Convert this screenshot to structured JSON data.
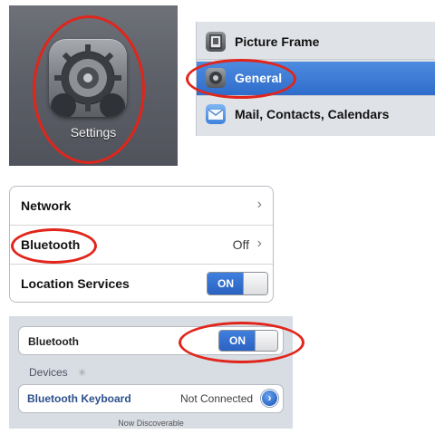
{
  "settings_app": {
    "label": "Settings",
    "icon": "gear-icon"
  },
  "sidebar": {
    "items": [
      {
        "label": "Picture Frame",
        "icon": "picture-frame-icon",
        "selected": false
      },
      {
        "label": "General",
        "icon": "gear-icon",
        "selected": true
      },
      {
        "label": "Mail, Contacts, Calendars",
        "icon": "mail-icon",
        "selected": false
      }
    ]
  },
  "general_settings": {
    "rows": [
      {
        "label": "Network",
        "value": "",
        "accessory": "chevron"
      },
      {
        "label": "Bluetooth",
        "value": "Off",
        "accessory": "chevron"
      },
      {
        "label": "Location Services",
        "value": "",
        "accessory": "switch",
        "switch_label": "ON"
      }
    ]
  },
  "bluetooth_screen": {
    "toggle_label": "Bluetooth",
    "toggle_value": "ON",
    "devices_header": "Devices",
    "device": {
      "name": "Bluetooth Keyboard",
      "status": "Not Connected"
    },
    "footer": "Now Discoverable"
  },
  "colors": {
    "highlight_red": "#e1251b",
    "selection_blue": "#2f6ccb",
    "switch_blue": "#2b62c2"
  }
}
